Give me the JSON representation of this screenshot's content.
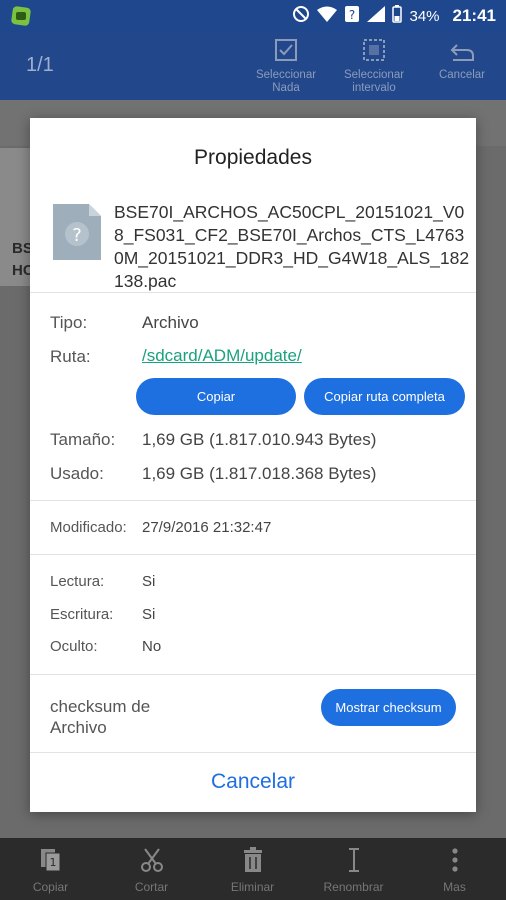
{
  "status_bar": {
    "battery": "34%",
    "time": "21:41",
    "app_icon": "android-app-icon"
  },
  "action_bar": {
    "count": "1/1",
    "buttons": [
      {
        "label": "Seleccionar Nada",
        "icon": "checkbox-icon"
      },
      {
        "label": "Seleccionar intervalo",
        "icon": "range-select-icon"
      },
      {
        "label": "Cancelar",
        "icon": "undo-icon"
      }
    ]
  },
  "background": {
    "tile_text_line1": "BS",
    "tile_text_line2": "HC"
  },
  "dialog": {
    "title": "Propiedades",
    "file_name": "BSE70I_ARCHOS_AC50CPL_20151021_V08_FS031_CF2_BSE70I_Archos_CTS_L47630M_20151021_DDR3_HD_G4W18_ALS_182138.pac",
    "file_icon": "unknown-file-icon",
    "type_label": "Tipo:",
    "type_value": "Archivo",
    "path_label": "Ruta:",
    "path_value": "/sdcard/ADM/update/",
    "copy_button": "Copiar",
    "copy_full_path_button": "Copiar ruta completa",
    "size_label": "Tamaño:",
    "size_value": "1,69 GB (1.817.010.943 Bytes)",
    "used_label": "Usado:",
    "used_value": "1,69 GB (1.817.018.368 Bytes)",
    "modified_label": "Modificado:",
    "modified_value": "27/9/2016 21:32:47",
    "read_label": "Lectura:",
    "read_value": "Si",
    "write_label": "Escritura:",
    "write_value": "Si",
    "hidden_label": "Oculto:",
    "hidden_value": "No",
    "checksum_label": "checksum de Archivo",
    "checksum_button": "Mostrar checksum",
    "cancel_button": "Cancelar"
  },
  "bottom_bar": [
    {
      "label": "Copiar",
      "icon": "copy-icon"
    },
    {
      "label": "Cortar",
      "icon": "scissors-icon"
    },
    {
      "label": "Eliminar",
      "icon": "trash-icon"
    },
    {
      "label": "Renombrar",
      "icon": "rename-icon"
    },
    {
      "label": "Mas",
      "icon": "more-vert-icon"
    }
  ]
}
